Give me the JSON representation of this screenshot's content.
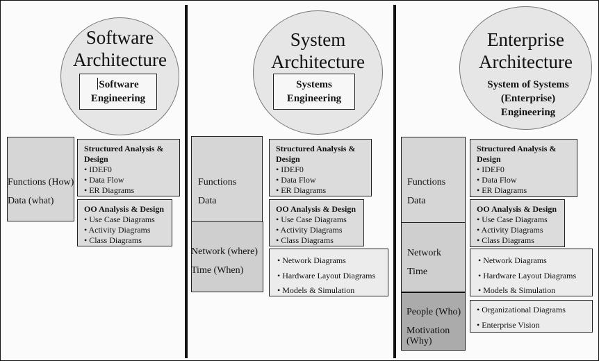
{
  "columns": [
    {
      "title_line1": "Software",
      "title_line2": "Architecture",
      "engineering_line1": "Software",
      "engineering_line2": "Engineering",
      "categories": [
        {
          "lines": [
            "Functions (How)",
            "Data (what)"
          ],
          "shade": "light"
        }
      ],
      "boxes": [
        {
          "heading_line1": "Structured Analysis &",
          "heading_line2": "Design",
          "items": [
            "• IDEF0",
            "• Data Flow",
            "• ER Diagrams"
          ]
        },
        {
          "heading_line1": "OO Analysis & Design",
          "items": [
            "• Use Case Diagrams",
            "• Activity Diagrams",
            "• Class Diagrams"
          ]
        }
      ]
    },
    {
      "title_line1": "System",
      "title_line2": "Architecture",
      "engineering_line1": "Systems",
      "engineering_line2": "Engineering",
      "categories": [
        {
          "lines": [
            "Functions",
            "Data"
          ],
          "shade": "light"
        },
        {
          "lines": [
            "Network  (where)",
            "Time (When)"
          ],
          "shade": "mid"
        }
      ],
      "boxes": [
        {
          "heading_line1": "Structured Analysis &",
          "heading_line2": "Design",
          "items": [
            "• IDEF0",
            "• Data Flow",
            "• ER Diagrams"
          ]
        },
        {
          "heading_line1": "OO Analysis & Design",
          "items": [
            "• Use Case Diagrams",
            "• Activity Diagrams",
            "• Class Diagrams"
          ]
        },
        {
          "items": [
            "•  Network Diagrams",
            "•  Hardware Layout Diagrams",
            "•  Models & Simulation"
          ]
        }
      ]
    },
    {
      "title_line1": "Enterprise",
      "title_line2": "Architecture",
      "engineering_line1": "System of Systems",
      "engineering_line2": "(Enterprise)",
      "engineering_line3": "Engineering",
      "categories": [
        {
          "lines": [
            "Functions",
            "Data"
          ],
          "shade": "light"
        },
        {
          "lines": [
            "Network",
            "Time"
          ],
          "shade": "mid"
        },
        {
          "lines": [
            "People (Who)",
            "Motivation",
            "(Why)"
          ],
          "shade": "dark"
        }
      ],
      "boxes": [
        {
          "heading_line1": "Structured Analysis &",
          "heading_line2": "Design",
          "items": [
            "• IDEF0",
            "• Data Flow",
            "• ER Diagrams"
          ]
        },
        {
          "heading_line1": "OO Analysis & Design",
          "items": [
            "• Use Case Diagrams",
            "• Activity Diagrams",
            "• Class Diagrams"
          ]
        },
        {
          "items": [
            "•  Network Diagrams",
            "•  Hardware Layout Diagrams",
            "•  Models & Simulation"
          ]
        },
        {
          "items": [
            "• Organizational Diagrams",
            "• Enterprise Vision"
          ]
        }
      ]
    }
  ]
}
